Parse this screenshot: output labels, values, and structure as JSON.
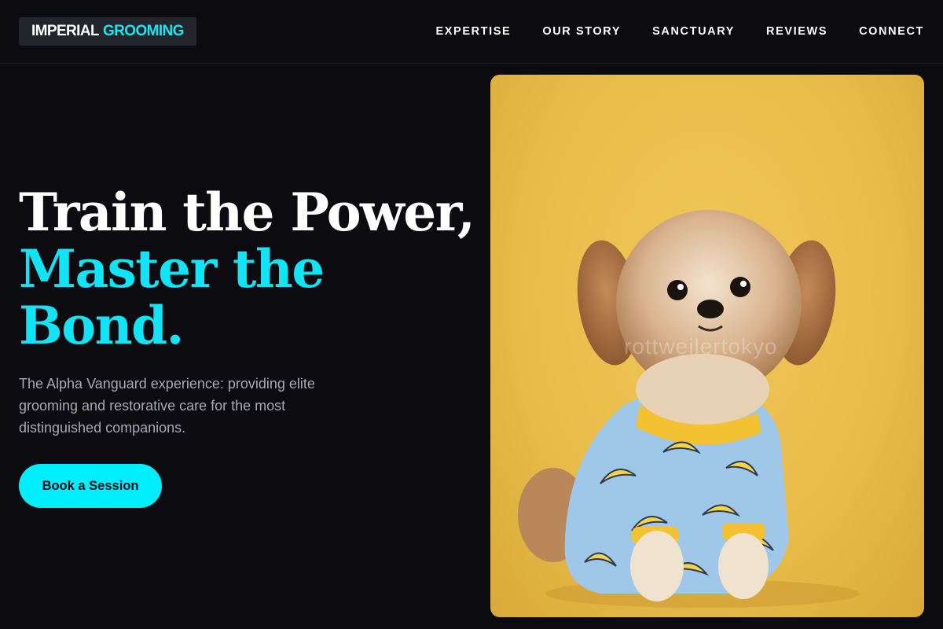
{
  "header": {
    "logo_primary": "IMPERIAL",
    "logo_accent": "GROOMING",
    "nav": [
      "EXPERTISE",
      "OUR STORY",
      "SANCTUARY",
      "REVIEWS",
      "CONNECT"
    ]
  },
  "hero": {
    "title_line1": "Train the Power,",
    "title_accent": "Master the Bond.",
    "subtitle": "The Alpha Vanguard experience: providing elite grooming and restorative care for the most distinguished companions.",
    "cta_label": "Book a Session"
  },
  "image": {
    "watermark": "rottweilertokyo",
    "subject": "small fluffy dog in blue banana-print pajamas on yellow background"
  },
  "colors": {
    "background": "#0b0b10",
    "accent": "#12e3f5",
    "button": "#00eefc",
    "photo_background": "#e9bd4b"
  }
}
